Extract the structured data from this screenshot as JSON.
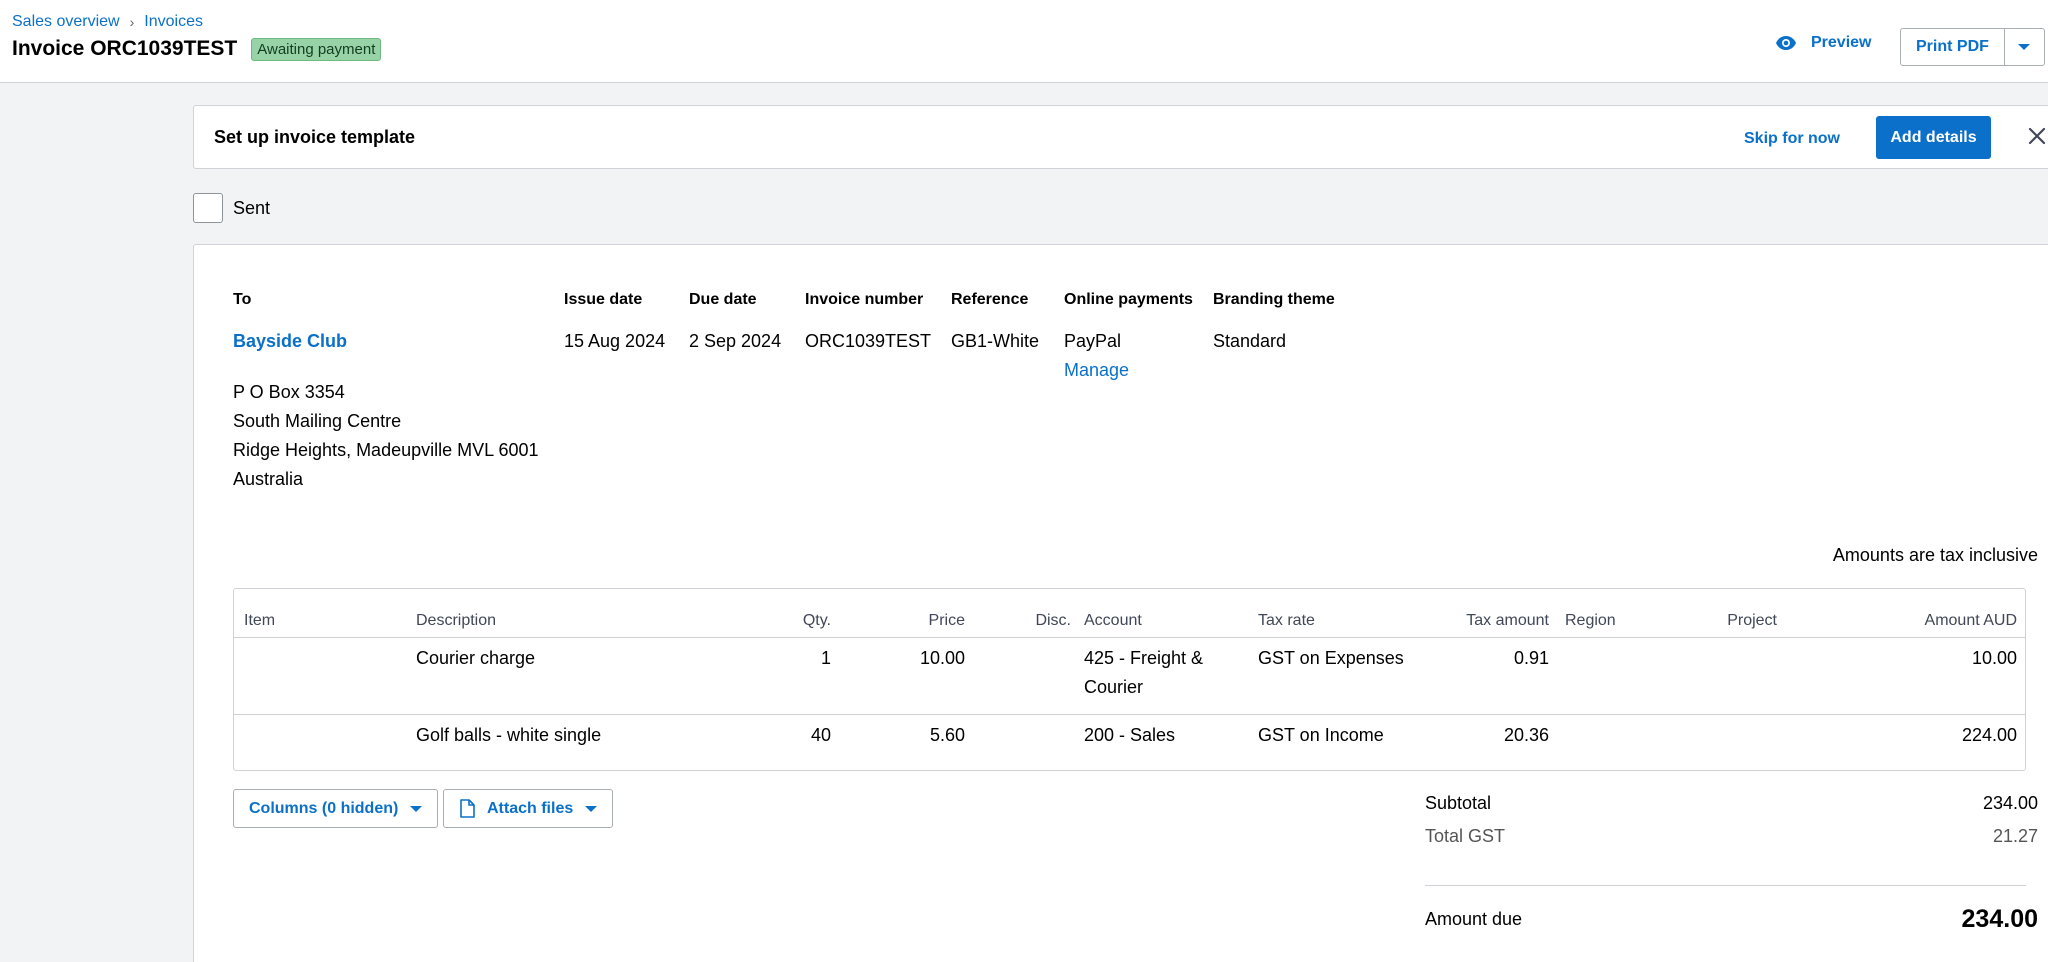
{
  "breadcrumb": {
    "item1": "Sales overview",
    "item2": "Invoices"
  },
  "header": {
    "title": "Invoice ORC1039TEST",
    "status": "Awaiting payment",
    "preview_label": "Preview",
    "print_label": "Print PDF"
  },
  "banner": {
    "title": "Set up invoice template",
    "skip_label": "Skip for now",
    "add_label": "Add details"
  },
  "sent": {
    "label": "Sent",
    "checked": false
  },
  "invoice": {
    "labels": {
      "to": "To",
      "issue_date": "Issue date",
      "due_date": "Due date",
      "invoice_number": "Invoice number",
      "reference": "Reference",
      "online_payments": "Online payments",
      "branding_theme": "Branding theme"
    },
    "contact": "Bayside Club",
    "address": [
      "P O Box 3354",
      "South Mailing Centre",
      "Ridge Heights, Madeupville MVL 6001",
      "Australia"
    ],
    "issue_date": "15 Aug 2024",
    "due_date": "2 Sep 2024",
    "invoice_number": "ORC1039TEST",
    "reference": "GB1-White",
    "online_payments": "PayPal",
    "manage_label": "Manage",
    "branding_theme": "Standard"
  },
  "tax_note": "Amounts are tax inclusive",
  "table": {
    "headers": {
      "item": "Item",
      "description": "Description",
      "qty": "Qty.",
      "price": "Price",
      "disc": "Disc.",
      "account": "Account",
      "tax_rate": "Tax rate",
      "tax_amount": "Tax amount",
      "region": "Region",
      "project": "Project",
      "amount": "Amount AUD"
    },
    "rows": [
      {
        "description": "Courier charge",
        "qty": "1",
        "price": "10.00",
        "account_line1": "425 - Freight &",
        "account_line2": "Courier",
        "tax_rate": "GST on Expenses",
        "tax_amount": "0.91",
        "amount": "10.00"
      },
      {
        "description": "Golf balls - white single",
        "qty": "40",
        "price": "5.60",
        "account_line1": "200 - Sales",
        "account_line2": "",
        "tax_rate": "GST on Income",
        "tax_amount": "20.36",
        "amount": "224.00"
      }
    ]
  },
  "footer": {
    "columns_label": "Columns (0 hidden)",
    "attach_label": "Attach files"
  },
  "totals": {
    "subtotal_label": "Subtotal",
    "subtotal": "234.00",
    "gst_label": "Total GST",
    "gst": "21.27",
    "due_label": "Amount due",
    "due": "234.00"
  },
  "colors": {
    "accent": "#0b70c9",
    "status_badge": "#98d3a8"
  }
}
